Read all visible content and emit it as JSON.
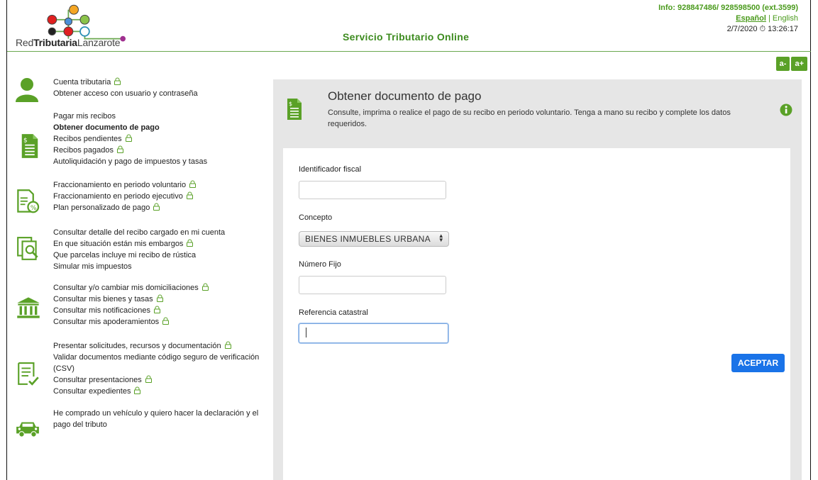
{
  "header": {
    "logo_text_pre": "Red",
    "logo_text_strong": "Tributaria",
    "logo_text_post": "Lanzarote",
    "title": "Servicio Tributario Online",
    "info": "Info: 928847486/ 928598500 (ext.3599)",
    "lang_active": "Español",
    "lang_other": "| English",
    "date": "2/7/2020",
    "time": "13:26:17",
    "font_smaller": "a-",
    "font_larger": "a+"
  },
  "sidebar": {
    "groups": [
      {
        "icon": "user-icon",
        "items": [
          {
            "label": "Cuenta tributaria",
            "lock": true
          },
          {
            "label": "Obtener acceso con usuario y contraseña",
            "lock": false
          }
        ]
      },
      {
        "icon": "receipt-icon",
        "items": [
          {
            "label": "Pagar mis recibos",
            "lock": false
          },
          {
            "label": "Obtener documento de pago",
            "lock": false,
            "active": true
          },
          {
            "label": "Recibos pendientes",
            "lock": true
          },
          {
            "label": "Recibos pagados",
            "lock": true
          },
          {
            "label": "Autoliquidación y pago de impuestos y tasas",
            "lock": false
          }
        ]
      },
      {
        "icon": "installment-icon",
        "items": [
          {
            "label": "Fraccionamiento en periodo voluntario",
            "lock": true
          },
          {
            "label": "Fraccionamiento en periodo ejecutivo",
            "lock": true
          },
          {
            "label": "Plan personalizado de pago",
            "lock": true
          }
        ]
      },
      {
        "icon": "document-search-icon",
        "items": [
          {
            "label": "Consultar detalle del recibo cargado en mi cuenta",
            "lock": false
          },
          {
            "label": "En que situación están mis embargos",
            "lock": true
          },
          {
            "label": "Que parcelas incluye mi recibo de rústica",
            "lock": false
          },
          {
            "label": "Simular mis impuestos",
            "lock": false
          }
        ]
      },
      {
        "icon": "bank-icon",
        "items": [
          {
            "label": "Consultar y/o cambiar mis domiciliaciones",
            "lock": true
          },
          {
            "label": "Consultar mis bienes y tasas",
            "lock": true
          },
          {
            "label": "Consultar mis notificaciones",
            "lock": true
          },
          {
            "label": "Consultar mis apoderamientos",
            "lock": true
          }
        ]
      },
      {
        "icon": "checklist-icon",
        "items": [
          {
            "label": "Presentar solicitudes, recursos y documentación",
            "lock": true
          },
          {
            "label": "Validar documentos mediante código seguro de verificación (CSV)",
            "lock": false
          },
          {
            "label": "Consultar presentaciones",
            "lock": true
          },
          {
            "label": "Consultar expedientes",
            "lock": true
          }
        ]
      },
      {
        "icon": "car-icon",
        "items": [
          {
            "label": "He comprado un vehículo y quiero hacer la declaración y el pago del tributo",
            "lock": false
          }
        ]
      }
    ]
  },
  "main": {
    "title": "Obtener documento de pago",
    "description": "Consulte, imprima o realice el pago de su recibo en periodo voluntario. Tenga a mano su recibo y complete los datos requeridos.",
    "form": {
      "fiscal_id_label": "Identificador fiscal",
      "fiscal_id_value": "",
      "concept_label": "Concepto",
      "concept_value": "BIENES INMUEBLES URBANA",
      "fixed_number_label": "Número Fijo",
      "fixed_number_value": "",
      "cadastral_label": "Referencia catastral",
      "cadastral_value": "",
      "submit_label": "ACEPTAR"
    }
  },
  "colors": {
    "brand_green": "#5aa127",
    "title_green": "#3d8b1f",
    "accept_blue": "#1a73e8",
    "panel_gray": "#e6e6e6"
  }
}
